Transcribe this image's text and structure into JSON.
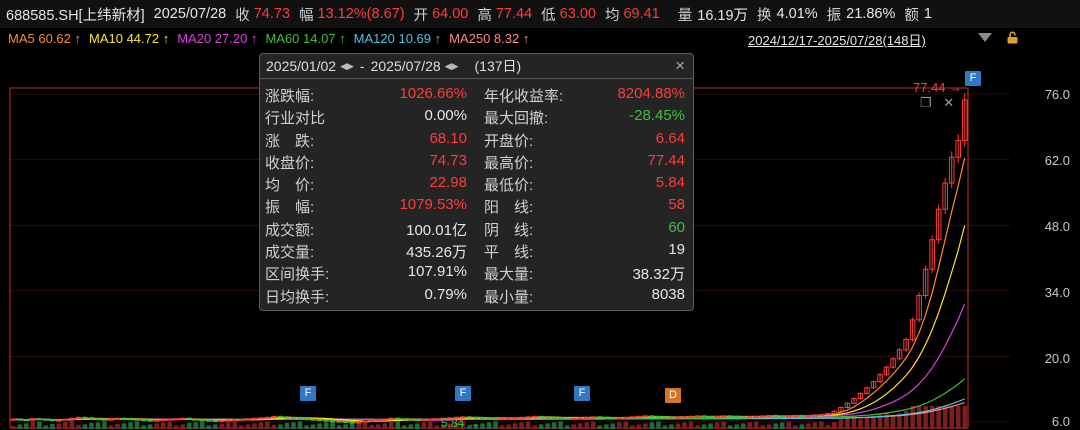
{
  "header": {
    "symbol": "688585.SH[上纬新材]",
    "date": "2025/07/28",
    "close_label": "收",
    "close": "74.73",
    "change_label": "幅",
    "change": "13.12%(8.67)",
    "open_label": "开",
    "open": "64.00",
    "high_label": "高",
    "high": "77.44",
    "low_label": "低",
    "low": "63.00",
    "avg_label": "均",
    "avg": "69.41",
    "volume_label": "量",
    "volume": "16.19万",
    "turnover_label": "换",
    "turnover": "4.01%",
    "amplitude_label": "振",
    "amplitude": "21.86%",
    "amount_label": "额",
    "amount": "1"
  },
  "ma_bar": [
    {
      "label": "MA5 60.62 ↑",
      "color": "#ff8c2a"
    },
    {
      "label": "MA10 44.72 ↑",
      "color": "#ffe32a"
    },
    {
      "label": "MA20 27.20 ↑",
      "color": "#e040e0"
    },
    {
      "label": "MA60 14.07 ↑",
      "color": "#3fbf3f"
    },
    {
      "label": "MA120 10.69 ↑",
      "color": "#49c6e5"
    },
    {
      "label": "MA250 8.32 ↑",
      "color": "#ff8a8a"
    }
  ],
  "range_selector": {
    "label": "2024/12/17-2025/07/28(148日)"
  },
  "y_axis": [
    "76.0",
    "62.0",
    "48.0",
    "34.0",
    "20.0",
    "6.0"
  ],
  "popup": {
    "start_date": "2025/01/02",
    "sep": "-",
    "end_date": "2025/07/28",
    "days": "(137日)",
    "close_icon": "×",
    "rows": [
      {
        "l1": "涨跌幅:",
        "v1": "1026.66%",
        "c1": "red",
        "l2": "年化收益率:",
        "v2": "8204.88%",
        "c2": "red"
      },
      {
        "l1": "行业对比",
        "v1": "0.00%",
        "c1": "wht",
        "l2": "最大回撤:",
        "v2": "-28.45%",
        "c2": "grn"
      },
      {
        "l1": "涨　跌:",
        "v1": "68.10",
        "c1": "red",
        "l2": "开盘价:",
        "v2": "6.64",
        "c2": "red"
      },
      {
        "l1": "收盘价:",
        "v1": "74.73",
        "c1": "red",
        "l2": "最高价:",
        "v2": "77.44",
        "c2": "red"
      },
      {
        "l1": "均　价:",
        "v1": "22.98",
        "c1": "red",
        "l2": "最低价:",
        "v2": "5.84",
        "c2": "red"
      },
      {
        "l1": "振　幅:",
        "v1": "1079.53%",
        "c1": "red",
        "l2": "阳　线:",
        "v2": "58",
        "c2": "red"
      },
      {
        "l1": "成交额:",
        "v1": "100.01亿",
        "c1": "wht",
        "l2": "阴　线:",
        "v2": "60",
        "c2": "grn"
      },
      {
        "l1": "成交量:",
        "v1": "435.26万",
        "c1": "wht",
        "l2": "平　线:",
        "v2": "19",
        "c2": "wht"
      },
      {
        "l1": "区间换手:",
        "v1": "107.91%",
        "c1": "wht",
        "l2": "最大量:",
        "v2": "38.32万",
        "c2": "wht"
      },
      {
        "l1": "日均换手:",
        "v1": "0.79%",
        "c1": "wht",
        "l2": "最小量:",
        "v2": "8038",
        "c2": "wht"
      }
    ]
  },
  "markers": {
    "max_label": "77.44 →",
    "min_label": "5.84 →",
    "f": "F",
    "d": "D"
  },
  "chart_data": {
    "type": "line",
    "title": "",
    "period_days": 148,
    "ylim": [
      6.0,
      76.0
    ],
    "price_close_approx": [
      6.6,
      6.5,
      6.4,
      6.7,
      6.6,
      6.5,
      6.3,
      6.4,
      6.6,
      6.8,
      7.0,
      6.9,
      6.7,
      6.6,
      6.5,
      6.6,
      6.8,
      6.7,
      6.6,
      6.5,
      6.4,
      6.3,
      6.4,
      6.5,
      6.6,
      6.7,
      6.8,
      6.6,
      6.5,
      6.4,
      6.3,
      6.2,
      6.3,
      6.4,
      6.5,
      6.6,
      6.7,
      6.8,
      6.9,
      7.0,
      7.2,
      7.1,
      6.9,
      6.8,
      6.7,
      6.6,
      6.5,
      6.4,
      6.3,
      6.2,
      6.1,
      6.0,
      5.9,
      6.0,
      6.2,
      6.4,
      6.5,
      6.6,
      6.8,
      6.7,
      6.6,
      6.5,
      6.4,
      6.5,
      6.6,
      6.7,
      6.8,
      6.9,
      7.0,
      7.1,
      7.0,
      6.9,
      6.8,
      6.7,
      6.6,
      6.7,
      6.8,
      6.9,
      7.0,
      7.1,
      7.2,
      7.1,
      7.0,
      6.9,
      6.8,
      6.7,
      6.8,
      6.9,
      7.0,
      7.1,
      7.0,
      6.9,
      6.8,
      6.9,
      7.0,
      7.1,
      7.2,
      7.3,
      7.2,
      7.1,
      7.0,
      6.9,
      7.0,
      7.1,
      7.2,
      7.3,
      7.2,
      7.1,
      7.2,
      7.3,
      7.2,
      7.1,
      7.0,
      7.1,
      7.2,
      7.3,
      7.4,
      7.3,
      7.2,
      7.3,
      7.4,
      7.3,
      7.4,
      7.5,
      7.6,
      7.8,
      8.3,
      9.1,
      10.0,
      11.0,
      12.1,
      13.3,
      14.6,
      16.1,
      17.7,
      19.5,
      21.4,
      23.6,
      27.8,
      33.0,
      38.6,
      44.9,
      51.4,
      57.0,
      62.5,
      66.1,
      74.73
    ],
    "ma_last": {
      "MA5": 60.62,
      "MA10": 44.72,
      "MA20": 27.2,
      "MA60": 14.07,
      "MA120": 10.69,
      "MA250": 8.32
    },
    "high": 77.44,
    "low": 5.84
  }
}
